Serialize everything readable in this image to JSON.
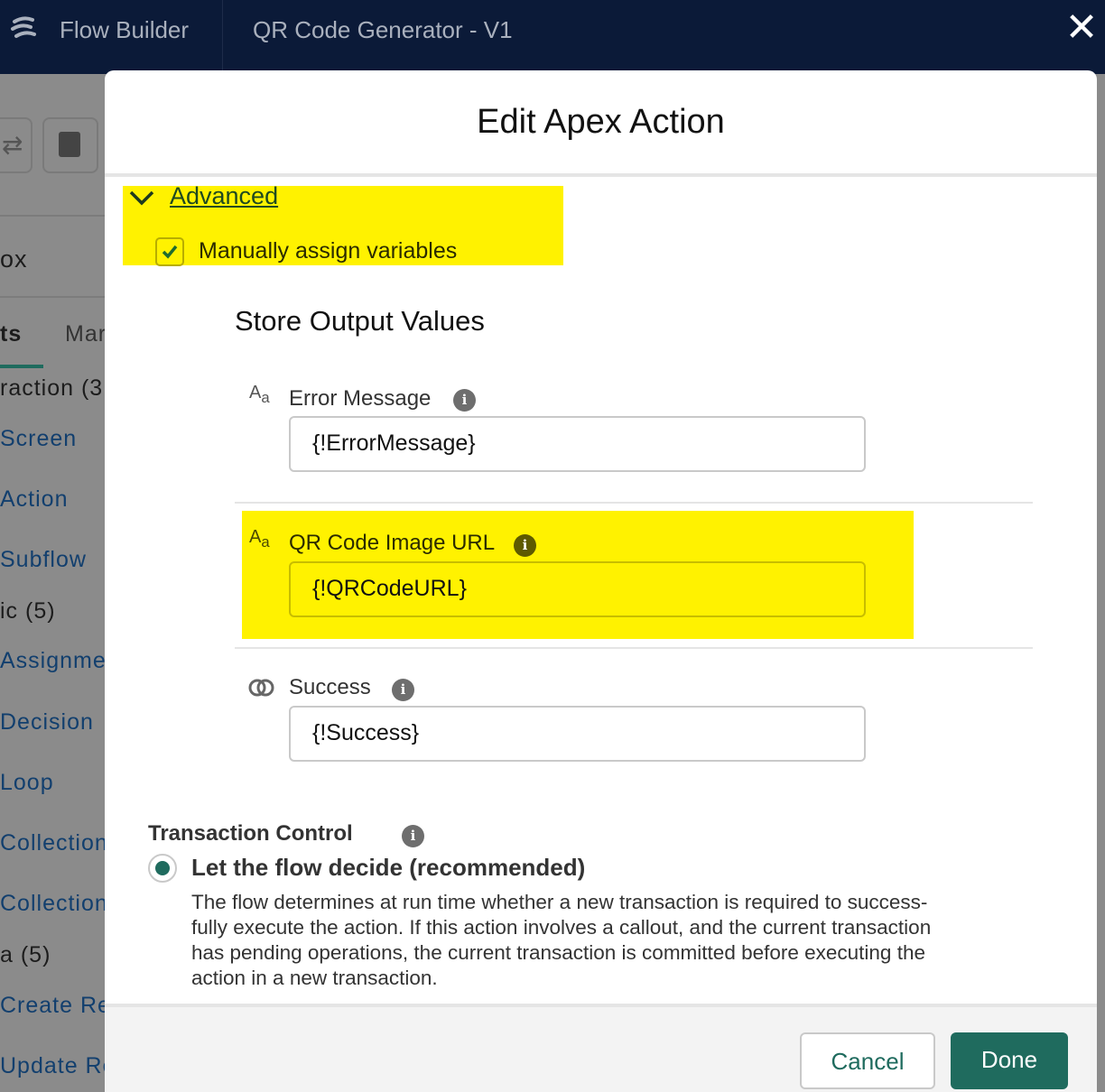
{
  "app": {
    "name": "Flow Builder",
    "flow_title": "QR Code Generator - V1",
    "close_icon": "close-icon"
  },
  "sidebar": {
    "toolbox_partial": "ox",
    "tabs": [
      "ts",
      "Mar"
    ],
    "items": [
      {
        "label": "raction (3",
        "type": "header"
      },
      {
        "label": "Screen",
        "type": "link"
      },
      {
        "label": "Action",
        "type": "link"
      },
      {
        "label": "Subflow",
        "type": "link"
      },
      {
        "label": "ic (5)",
        "type": "header"
      },
      {
        "label": "Assignme",
        "type": "link"
      },
      {
        "label": "Decision",
        "type": "link"
      },
      {
        "label": "Loop",
        "type": "link"
      },
      {
        "label": "Collection",
        "type": "link"
      },
      {
        "label": "Collection",
        "type": "link"
      },
      {
        "label": "a (5)",
        "type": "header"
      },
      {
        "label": "Create Re",
        "type": "link"
      },
      {
        "label": "Update Re",
        "type": "link"
      }
    ]
  },
  "modal": {
    "title": "Edit Apex Action",
    "advanced": {
      "label": "Advanced",
      "expanded": true,
      "manual_assign_label": "Manually assign variables",
      "manual_assign_checked": true
    },
    "store_output": {
      "heading": "Store Output Values",
      "fields": [
        {
          "label": "Error Message",
          "value": "{!ErrorMessage}",
          "type_icon": "text-type-icon",
          "highlighted": false
        },
        {
          "label": "QR Code Image URL",
          "value": "{!QRCodeURL}",
          "type_icon": "text-type-icon",
          "highlighted": true
        },
        {
          "label": "Success",
          "value": "{!Success}",
          "type_icon": "boolean-type-icon",
          "highlighted": false
        }
      ]
    },
    "transaction": {
      "heading": "Transaction Control",
      "option_label": "Let the flow decide (recommended)",
      "option_selected": true,
      "description_lines": [
        "The flow determines at run time whether a new transaction is required to success-",
        "fully execute the action. If this action involves a callout, and the current transaction",
        "has pending operations, the current transaction is committed before executing the",
        "action in a new transaction."
      ]
    },
    "footer": {
      "cancel": "Cancel",
      "done": "Done"
    }
  },
  "colors": {
    "header": "#0b1a38",
    "highlight": "#fff200",
    "brand": "#1f6b5e",
    "link": "#123f6e"
  }
}
